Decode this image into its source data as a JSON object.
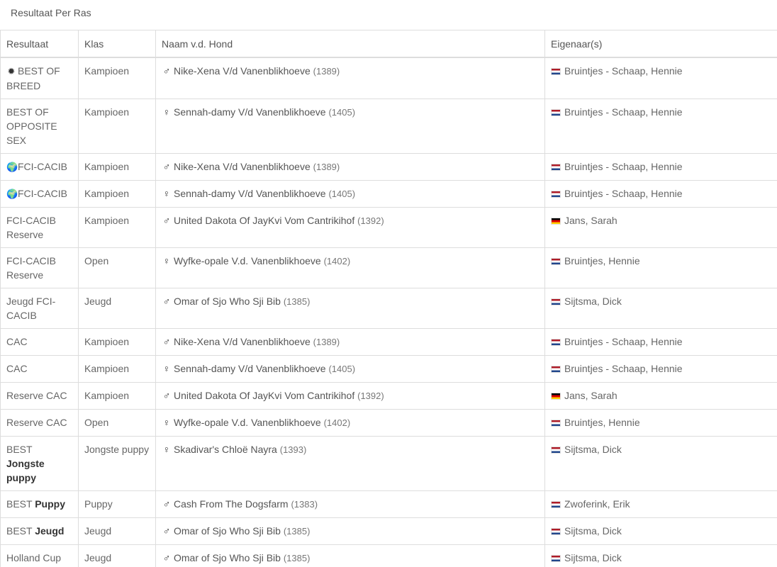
{
  "page": {
    "section_title": "Resultaat Per Ras"
  },
  "table": {
    "headers": [
      "Resultaat",
      "Klas",
      "Naam v.d. Hond",
      "Eigenaar(s)"
    ],
    "rows": [
      {
        "result_pre": "",
        "result_icon": "✹",
        "result": "BEST OF BREED",
        "result_strong": "",
        "klas": "Kampioen",
        "sex": "♂",
        "dog": "Nike-Xena V/d Vanenblikhoeve",
        "num": "(1389)",
        "flag": "nl",
        "owner": "Bruintjes - Schaap, Hennie"
      },
      {
        "result_pre": "",
        "result_icon": "",
        "result": "BEST OF OPPOSITE SEX",
        "result_strong": "",
        "klas": "Kampioen",
        "sex": "♀",
        "dog": "Sennah-damy V/d Vanenblikhoeve",
        "num": "(1405)",
        "flag": "nl",
        "owner": "Bruintjes - Schaap, Hennie"
      },
      {
        "result_pre": "",
        "result_icon": "🌍",
        "result": "FCI-CACIB",
        "result_strong": "",
        "klas": "Kampioen",
        "sex": "♂",
        "dog": "Nike-Xena V/d Vanenblikhoeve",
        "num": "(1389)",
        "flag": "nl",
        "owner": "Bruintjes - Schaap, Hennie"
      },
      {
        "result_pre": "",
        "result_icon": "🌍",
        "result": "FCI-CACIB",
        "result_strong": "",
        "klas": "Kampioen",
        "sex": "♀",
        "dog": "Sennah-damy V/d Vanenblikhoeve",
        "num": "(1405)",
        "flag": "nl",
        "owner": "Bruintjes - Schaap, Hennie"
      },
      {
        "result_pre": "",
        "result_icon": "",
        "result": "FCI-CACIB Reserve",
        "result_strong": "",
        "klas": "Kampioen",
        "sex": "♂",
        "dog": "United Dakota Of JayKvi Vom Cantrikihof",
        "num": "(1392)",
        "flag": "de",
        "owner": "Jans, Sarah"
      },
      {
        "result_pre": "",
        "result_icon": "",
        "result": "FCI-CACIB Reserve",
        "result_strong": "",
        "klas": "Open",
        "sex": "♀",
        "dog": "Wyfke-opale V.d. Vanenblikhoeve",
        "num": "(1402)",
        "flag": "nl",
        "owner": "Bruintjes, Hennie"
      },
      {
        "result_pre": "",
        "result_icon": "",
        "result": "Jeugd FCI-CACIB",
        "result_strong": "",
        "klas": "Jeugd",
        "sex": "♂",
        "dog": "Omar of Sjo Who Sji Bib",
        "num": "(1385)",
        "flag": "nl",
        "owner": "Sijtsma, Dick"
      },
      {
        "result_pre": "",
        "result_icon": "",
        "result": "CAC",
        "result_strong": "",
        "klas": "Kampioen",
        "sex": "♂",
        "dog": "Nike-Xena V/d Vanenblikhoeve",
        "num": "(1389)",
        "flag": "nl",
        "owner": "Bruintjes - Schaap, Hennie"
      },
      {
        "result_pre": "",
        "result_icon": "",
        "result": "CAC",
        "result_strong": "",
        "klas": "Kampioen",
        "sex": "♀",
        "dog": "Sennah-damy V/d Vanenblikhoeve",
        "num": "(1405)",
        "flag": "nl",
        "owner": "Bruintjes - Schaap, Hennie"
      },
      {
        "result_pre": "",
        "result_icon": "",
        "result": "Reserve CAC",
        "result_strong": "",
        "klas": "Kampioen",
        "sex": "♂",
        "dog": "United Dakota Of JayKvi Vom Cantrikihof",
        "num": "(1392)",
        "flag": "de",
        "owner": "Jans, Sarah"
      },
      {
        "result_pre": "",
        "result_icon": "",
        "result": "Reserve CAC",
        "result_strong": "",
        "klas": "Open",
        "sex": "♀",
        "dog": "Wyfke-opale V.d. Vanenblikhoeve",
        "num": "(1402)",
        "flag": "nl",
        "owner": "Bruintjes, Hennie"
      },
      {
        "result_pre": "BEST",
        "result_icon": "",
        "result": "",
        "result_strong": "Jongste puppy",
        "klas": "Jongste puppy",
        "sex": "♀",
        "dog": "Skadivar's Chloë Nayra",
        "num": "(1393)",
        "flag": "nl",
        "owner": "Sijtsma, Dick"
      },
      {
        "result_pre": "BEST",
        "result_icon": "",
        "result": "",
        "result_strong": "Puppy",
        "klas": "Puppy",
        "sex": "♂",
        "dog": "Cash From The Dogsfarm",
        "num": "(1383)",
        "flag": "nl",
        "owner": "Zwoferink, Erik"
      },
      {
        "result_pre": "BEST",
        "result_icon": "",
        "result": "",
        "result_strong": "Jeugd",
        "klas": "Jeugd",
        "sex": "♂",
        "dog": "Omar of Sjo Who Sji Bib",
        "num": "(1385)",
        "flag": "nl",
        "owner": "Sijtsma, Dick"
      },
      {
        "result_pre": "",
        "result_icon": "",
        "result": "Holland Cup Junior Winner",
        "result_strong": "",
        "klas": "Jeugd",
        "sex": "♂",
        "dog": "Omar of Sjo Who Sji Bib",
        "num": "(1385)",
        "flag": "nl",
        "owner": "Sijtsma, Dick"
      }
    ]
  },
  "colors": {
    "border": "#dddddd",
    "text": "#666666",
    "flag_nl": [
      "#ae1c28",
      "#ffffff",
      "#21468b"
    ],
    "flag_de": [
      "#000000",
      "#dd0000",
      "#ffce00"
    ]
  },
  "icons": {
    "best_of_breed": "burst-icon",
    "fci_cacib": "globe-icon",
    "male": "male-icon",
    "female": "female-icon"
  }
}
